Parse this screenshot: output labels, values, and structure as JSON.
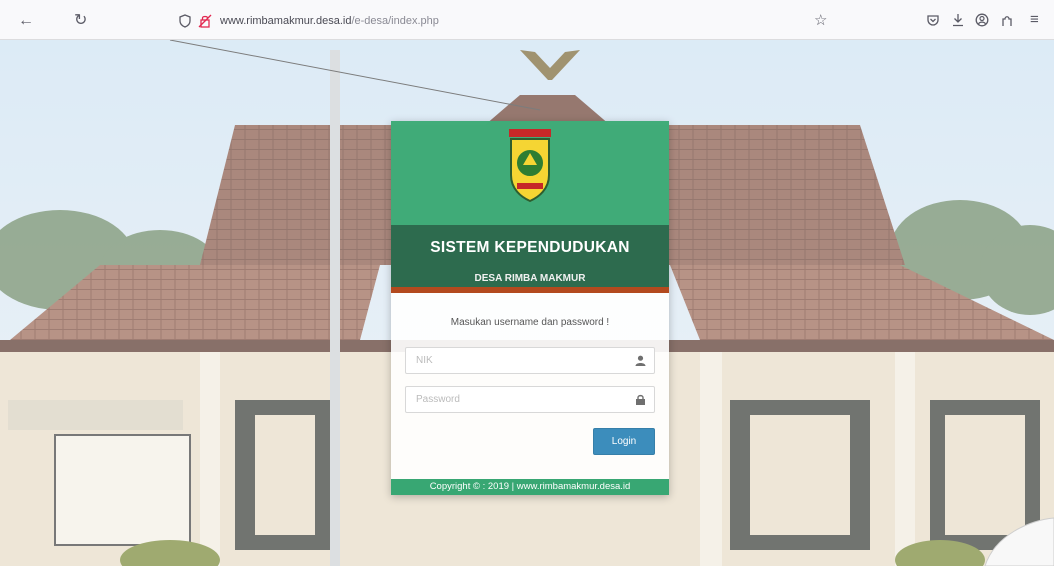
{
  "browser": {
    "url_host": "www.rimbamakmur.desa.id",
    "url_path": "/e-desa/index.php"
  },
  "login": {
    "title": "SISTEM KEPENDUDUKAN",
    "subtitle": "DESA RIMBA MAKMUR",
    "prompt": "Masukan username dan password !",
    "nik_placeholder": "NIK",
    "password_placeholder": "Password",
    "login_label": "Login",
    "footer": "Copyright © : 2019 | www.rimbamakmur.desa.id"
  },
  "icons": {
    "nik_field": "user-icon",
    "password_field": "lock-icon"
  }
}
